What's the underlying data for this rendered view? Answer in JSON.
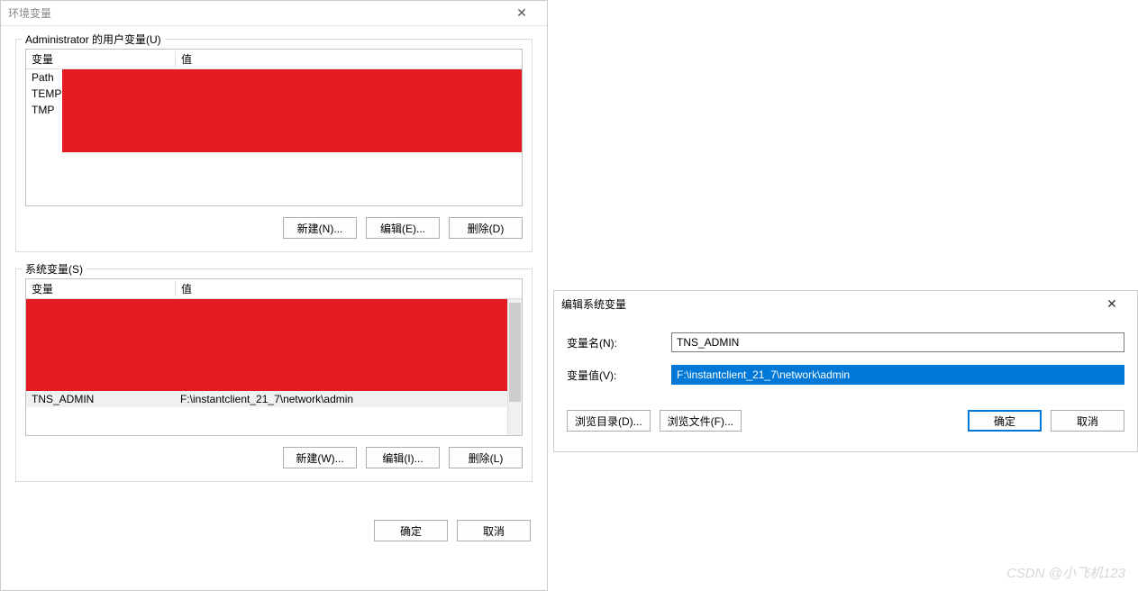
{
  "envDialog": {
    "title": "环境变量",
    "userSection": {
      "legend": "Administrator 的用户变量(U)",
      "headers": {
        "var": "变量",
        "val": "值"
      },
      "rows": [
        {
          "var": "Path",
          "val": ""
        },
        {
          "var": "TEMP",
          "val": ""
        },
        {
          "var": "TMP",
          "val": ""
        }
      ],
      "buttons": {
        "new": "新建(N)...",
        "edit": "编辑(E)...",
        "delete": "删除(D)"
      }
    },
    "sysSection": {
      "legend": "系统变量(S)",
      "headers": {
        "var": "变量",
        "val": "值"
      },
      "rows": [
        {
          "var": "TNS_ADMIN",
          "val": "F:\\instantclient_21_7\\network\\admin"
        }
      ],
      "buttons": {
        "new": "新建(W)...",
        "edit": "编辑(I)...",
        "delete": "删除(L)"
      }
    },
    "footer": {
      "ok": "确定",
      "cancel": "取消"
    }
  },
  "editDialog": {
    "title": "编辑系统变量",
    "nameLabel": "变量名(N):",
    "nameValue": "TNS_ADMIN",
    "valueLabel": "变量值(V):",
    "valueValue": "F:\\instantclient_21_7\\network\\admin",
    "buttons": {
      "browseDir": "浏览目录(D)...",
      "browseFile": "浏览文件(F)...",
      "ok": "确定",
      "cancel": "取消"
    }
  },
  "watermark": "CSDN @小飞机123"
}
